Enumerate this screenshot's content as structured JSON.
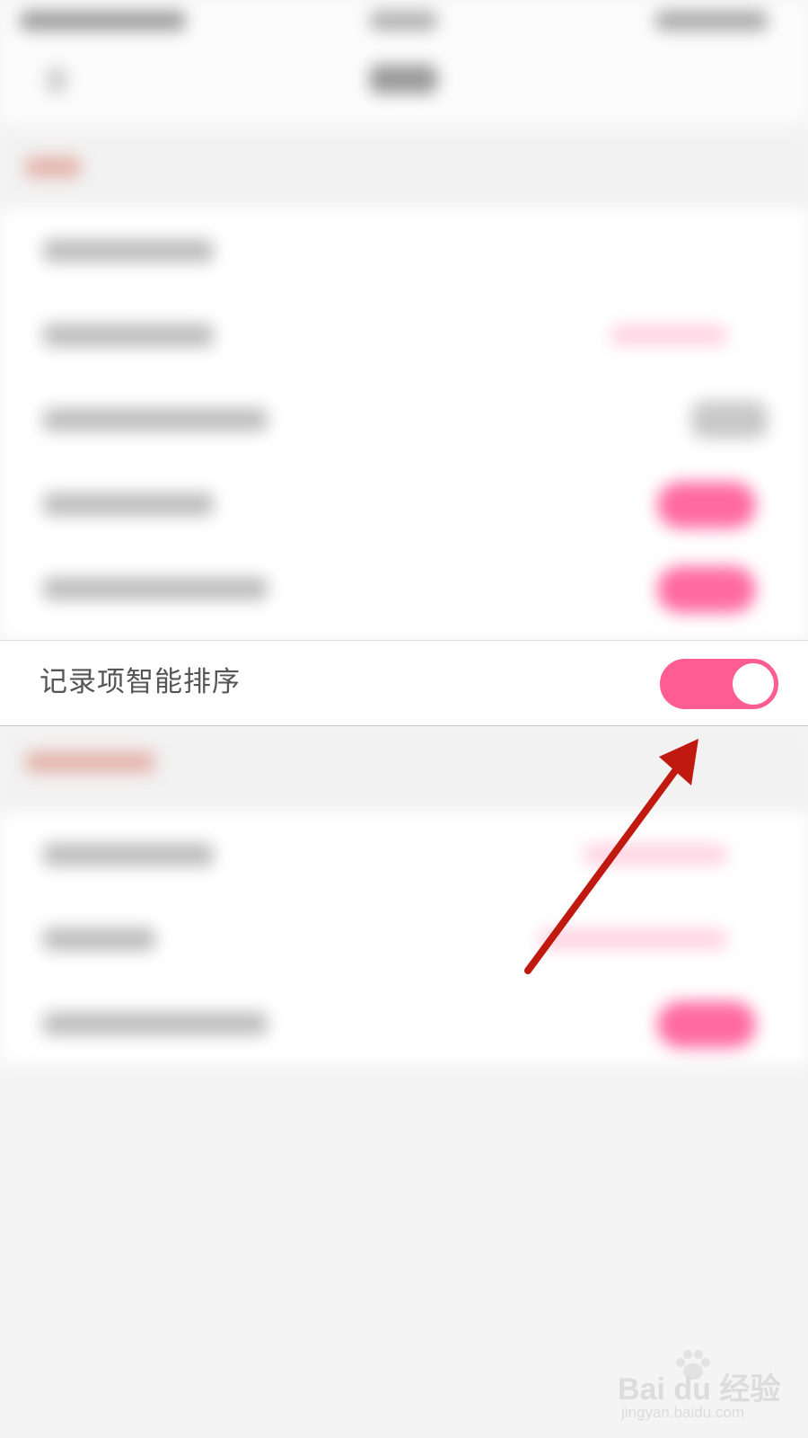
{
  "setting_row": {
    "label": "记录项智能排序",
    "toggle_on": true
  },
  "colors": {
    "toggle_active": "#ff5c93",
    "arrow": "#c0190f",
    "background": "#f4f4f4"
  },
  "watermark": {
    "logo_text": "Bai du 经验",
    "url": "jingyan.baidu.com"
  },
  "icons": {
    "watermark": "baidu-paw-icon",
    "annotation": "red-arrow-icon"
  }
}
